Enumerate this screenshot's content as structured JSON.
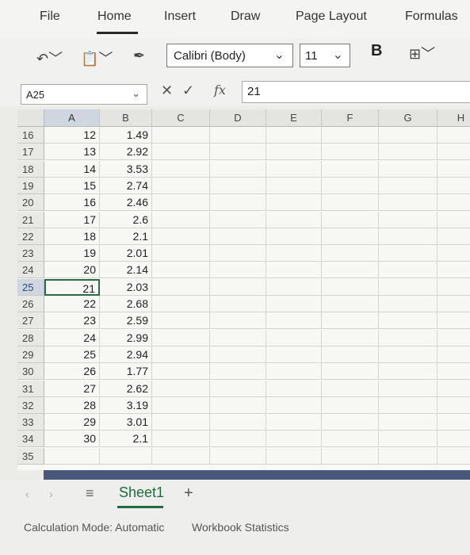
{
  "ribbon": {
    "tabs": [
      "File",
      "Home",
      "Insert",
      "Draw",
      "Page Layout",
      "Formulas"
    ],
    "active_tab": "Home"
  },
  "toolbar": {
    "font_name": "Calibri (Body)",
    "font_size": "11",
    "bold_label": "B"
  },
  "formula_bar": {
    "name_box": "A25",
    "fx_label": "fx",
    "value": "21"
  },
  "grid": {
    "columns": [
      "A",
      "B",
      "C",
      "D",
      "E",
      "F",
      "G",
      "H"
    ],
    "selected_column": "A",
    "rows": [
      {
        "num": "16",
        "a": "12",
        "b": "1.49"
      },
      {
        "num": "17",
        "a": "13",
        "b": "2.92"
      },
      {
        "num": "18",
        "a": "14",
        "b": "3.53"
      },
      {
        "num": "19",
        "a": "15",
        "b": "2.74"
      },
      {
        "num": "20",
        "a": "16",
        "b": "2.46"
      },
      {
        "num": "21",
        "a": "17",
        "b": "2.6"
      },
      {
        "num": "22",
        "a": "18",
        "b": "2.1"
      },
      {
        "num": "23",
        "a": "19",
        "b": "2.01"
      },
      {
        "num": "24",
        "a": "20",
        "b": "2.14"
      },
      {
        "num": "25",
        "a": "21",
        "b": "2.03"
      },
      {
        "num": "26",
        "a": "22",
        "b": "2.68"
      },
      {
        "num": "27",
        "a": "23",
        "b": "2.59"
      },
      {
        "num": "28",
        "a": "24",
        "b": "2.99"
      },
      {
        "num": "29",
        "a": "25",
        "b": "2.94"
      },
      {
        "num": "30",
        "a": "26",
        "b": "1.77"
      },
      {
        "num": "31",
        "a": "27",
        "b": "2.62"
      },
      {
        "num": "32",
        "a": "28",
        "b": "3.19"
      },
      {
        "num": "33",
        "a": "29",
        "b": "3.01"
      },
      {
        "num": "34",
        "a": "30",
        "b": "2.1"
      },
      {
        "num": "35",
        "a": "",
        "b": ""
      }
    ],
    "active_row": "25"
  },
  "sheets": {
    "tab_label": "Sheet1",
    "add_label": "+"
  },
  "status_bar": {
    "calc_mode": "Calculation Mode: Automatic",
    "workbook_stats": "Workbook Statistics"
  }
}
